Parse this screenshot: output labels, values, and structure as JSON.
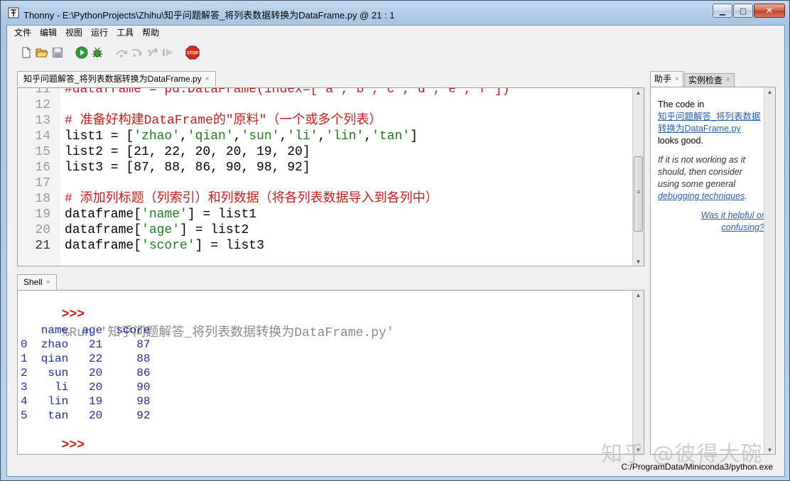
{
  "window": {
    "title": "Thonny  -  E:\\PythonProjects\\Zhihu\\知乎问题解答_将列表数据转换为DataFrame.py  @  21 : 1"
  },
  "menu": [
    "文件",
    "编辑",
    "视图",
    "运行",
    "工具",
    "帮助"
  ],
  "toolbar": [
    "new-file",
    "open-file",
    "save-file",
    "run",
    "debug",
    "step-over",
    "step-into",
    "step-out",
    "resume",
    "stop"
  ],
  "editor": {
    "tab_label": "知乎问题解答_将列表数据转换为DataFrame.py",
    "lines": [
      {
        "n": "11",
        "parts": [
          {
            "t": "#dataframe = pd.DataFrame(index=['a','b','c','d','e','f'])",
            "c": "cm"
          }
        ]
      },
      {
        "n": "12",
        "parts": [
          {
            "t": "",
            "c": ""
          }
        ]
      },
      {
        "n": "13",
        "parts": [
          {
            "t": "# 准备好构建DataFrame的\"原料\"（一个或多个列表）",
            "c": "cm"
          }
        ]
      },
      {
        "n": "14",
        "parts": [
          {
            "t": "list1 = [",
            "c": ""
          },
          {
            "t": "'zhao'",
            "c": "st"
          },
          {
            "t": ",",
            "c": ""
          },
          {
            "t": "'qian'",
            "c": "st"
          },
          {
            "t": ",",
            "c": ""
          },
          {
            "t": "'sun'",
            "c": "st"
          },
          {
            "t": ",",
            "c": ""
          },
          {
            "t": "'li'",
            "c": "st"
          },
          {
            "t": ",",
            "c": ""
          },
          {
            "t": "'lin'",
            "c": "st"
          },
          {
            "t": ",",
            "c": ""
          },
          {
            "t": "'tan'",
            "c": "st"
          },
          {
            "t": "]",
            "c": ""
          }
        ]
      },
      {
        "n": "15",
        "parts": [
          {
            "t": "list2 = [21, 22, 20, 20, 19, 20]",
            "c": ""
          }
        ]
      },
      {
        "n": "16",
        "parts": [
          {
            "t": "list3 = [87, 88, 86, 90, 98, 92]",
            "c": ""
          }
        ]
      },
      {
        "n": "17",
        "parts": [
          {
            "t": "",
            "c": ""
          }
        ]
      },
      {
        "n": "18",
        "parts": [
          {
            "t": "# 添加列标题（列索引）和列数据（将各列表数据导入到各列中）",
            "c": "cm"
          }
        ]
      },
      {
        "n": "19",
        "parts": [
          {
            "t": "dataframe[",
            "c": ""
          },
          {
            "t": "'name'",
            "c": "st"
          },
          {
            "t": "] = list1",
            "c": ""
          }
        ]
      },
      {
        "n": "20",
        "parts": [
          {
            "t": "dataframe[",
            "c": ""
          },
          {
            "t": "'age'",
            "c": "st"
          },
          {
            "t": "] = list2",
            "c": ""
          }
        ]
      },
      {
        "n": "21",
        "parts": [
          {
            "t": "dataframe[",
            "c": ""
          },
          {
            "t": "'score'",
            "c": "st"
          },
          {
            "t": "] = list3",
            "c": ""
          }
        ]
      }
    ]
  },
  "shell": {
    "tab_label": "Shell",
    "prompt": ">>>",
    "run_command": "%Run '知乎问题解答_将列表数据转换为DataFrame.py'",
    "output_lines": [
      "   name  age  score",
      "0  zhao   21     87",
      "1  qian   22     88",
      "2   sun   20     86",
      "3    li   20     90",
      "4   lin   19     98",
      "5   tan   20     92"
    ],
    "final_prompt": ">>>"
  },
  "assistant": {
    "tab_label": "助手",
    "tab2_label": "实例检查",
    "code_in": "The code in",
    "file_link": "知乎问题解答_将列表数据转换为DataFrame.py",
    "looks_good": "looks good.",
    "hint_pre": "If it is not working as it should, then consider using some general",
    "hint_link": "debugging techniques",
    "hint_post": ".",
    "feedback_link": "Was it helpful or confusing?"
  },
  "status": {
    "interpreter": "C:/ProgramData/Miniconda3/python.exe"
  },
  "watermark": "知乎 @彼得大碗"
}
